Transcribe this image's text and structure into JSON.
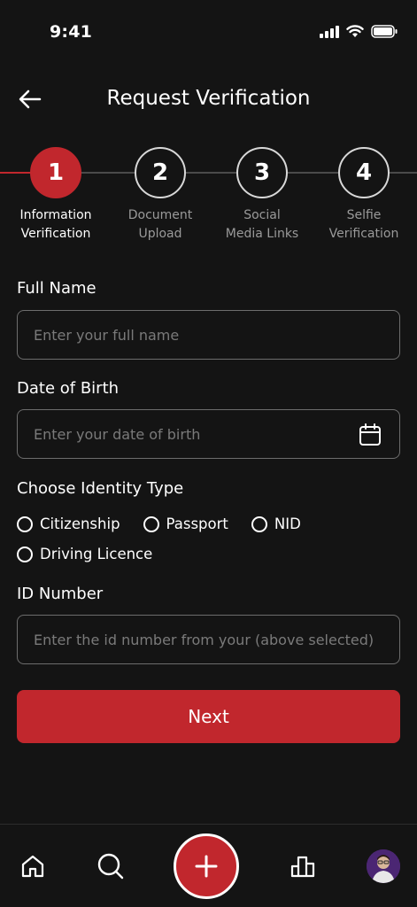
{
  "status_bar": {
    "time": "9:41"
  },
  "header": {
    "title": "Request Verification"
  },
  "stepper": {
    "steps": [
      {
        "number": "1",
        "label": "Information\nVerification"
      },
      {
        "number": "2",
        "label": "Document\nUpload"
      },
      {
        "number": "3",
        "label": "Social\nMedia Links"
      },
      {
        "number": "4",
        "label": "Selfie\nVerification"
      }
    ]
  },
  "form": {
    "full_name": {
      "label": "Full Name",
      "placeholder": "Enter your full name"
    },
    "dob": {
      "label": "Date of Birth",
      "placeholder": "Enter your date of birth"
    },
    "identity_type": {
      "label": "Choose Identity Type",
      "options": [
        "Citizenship",
        "Passport",
        "NID",
        "Driving Licence"
      ]
    },
    "id_number": {
      "label": "ID Number",
      "placeholder": "Enter the id number from your (above selected)"
    },
    "next_label": "Next"
  },
  "colors": {
    "accent": "#c1272d",
    "background": "#141414"
  }
}
